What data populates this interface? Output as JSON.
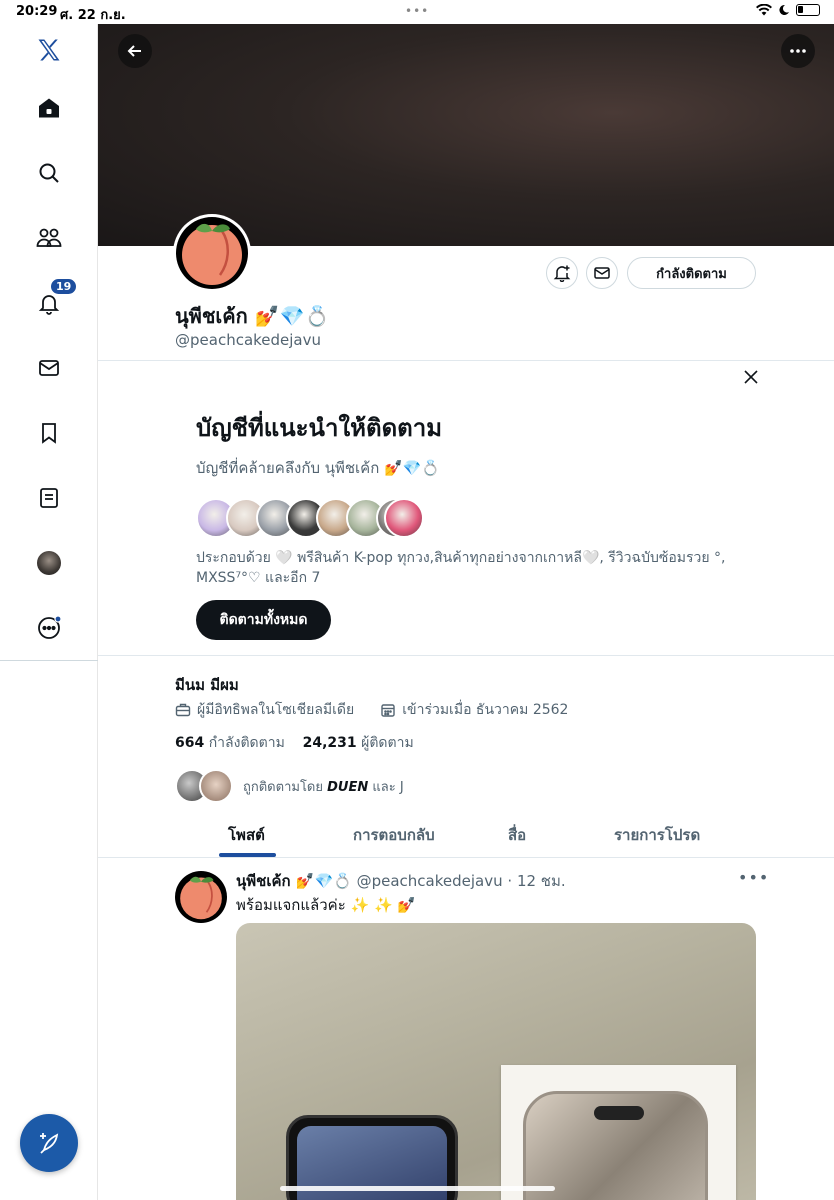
{
  "status_bar": {
    "time": "20:29",
    "date": "ศ. 22 ก.ย.",
    "dots": "•••"
  },
  "sidebar": {
    "notification_count": "19"
  },
  "profile": {
    "display_name": "นุพีชเค้ก 💅💎💍",
    "handle": "@peachcakedejavu",
    "following_button": "กำลังติดตาม",
    "bio": "มีนม มีผม",
    "category": "ผู้มีอิทธิพลในโซเชียลมีเดีย",
    "joined": "เข้าร่วมเมื่อ ธันวาคม 2562",
    "following_count": "664",
    "following_label": "กำลังติดตาม",
    "followers_count": "24,231",
    "followers_label": "ผู้ติดตาม",
    "followed_by_prefix": "ถูกติดตามโดย",
    "followed_by_name": "DUEN",
    "followed_by_suffix": "และ J"
  },
  "suggestions": {
    "title": "บัญชีที่แนะนำให้ติดตาม",
    "subtitle": "บัญชีที่คล้ายคลึงกับ นุพีชเค้ก 💅💎💍",
    "description": "ประกอบด้วย 🤍 พรีสินค้า K-pop ทุกวง,สินค้าทุกอย่างจากเกาหลี🤍, รีวิวฉบับซ้อมรวย °, MXSS⁷°♡ และอีก 7",
    "follow_all": "ติดตามทั้งหมด",
    "avatar_colors": [
      "#c9b8e6",
      "#d8c9c0",
      "#9aa0a8",
      "#3a3a3a",
      "#c8a88a",
      "#a7b59c",
      "#7d7a78",
      "#e0577a"
    ]
  },
  "tabs": [
    "โพสต์",
    "การตอบกลับ",
    "สื่อ",
    "รายการโปรด"
  ],
  "post": {
    "name": "นุพีชเค้ก 💅💎💍",
    "handle": "@peachcakedejavu",
    "time": "· 12 ชม.",
    "text": "พร้อมแจกแล้วค่ะ ✨ ✨ 💅",
    "more": "•••"
  },
  "colors": {
    "accent": "#1d4e9e",
    "compose": "#1c5aa8",
    "peach": "#ee8a6d"
  }
}
